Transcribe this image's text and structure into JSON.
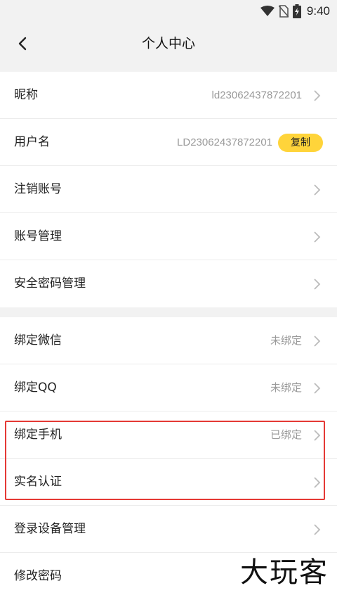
{
  "status_bar": {
    "time": "9:40",
    "icons": [
      "wifi-icon",
      "no-sim-icon",
      "battery-charging-icon"
    ]
  },
  "header": {
    "title": "个人中心",
    "back_icon": "chevron-left-icon"
  },
  "account_section": {
    "nickname": {
      "label": "昵称",
      "value": "ld23062437872201"
    },
    "username": {
      "label": "用户名",
      "value": "LD23062437872201",
      "copy_label": "复制"
    },
    "cancel_account": {
      "label": "注销账号"
    },
    "account_management": {
      "label": "账号管理"
    },
    "security_password": {
      "label": "安全密码管理"
    }
  },
  "binding_section": {
    "wechat": {
      "label": "绑定微信",
      "status": "未绑定"
    },
    "qq": {
      "label": "绑定QQ",
      "status": "未绑定"
    },
    "phone": {
      "label": "绑定手机",
      "status": "已绑定"
    },
    "real_name": {
      "label": "实名认证"
    },
    "device_management": {
      "label": "登录设备管理"
    },
    "change_password": {
      "label": "修改密码"
    }
  },
  "watermark": "大玩客",
  "colors": {
    "accent_yellow": "#ffd43a",
    "highlight_red": "#e53935",
    "background": "#f2f2f2"
  }
}
